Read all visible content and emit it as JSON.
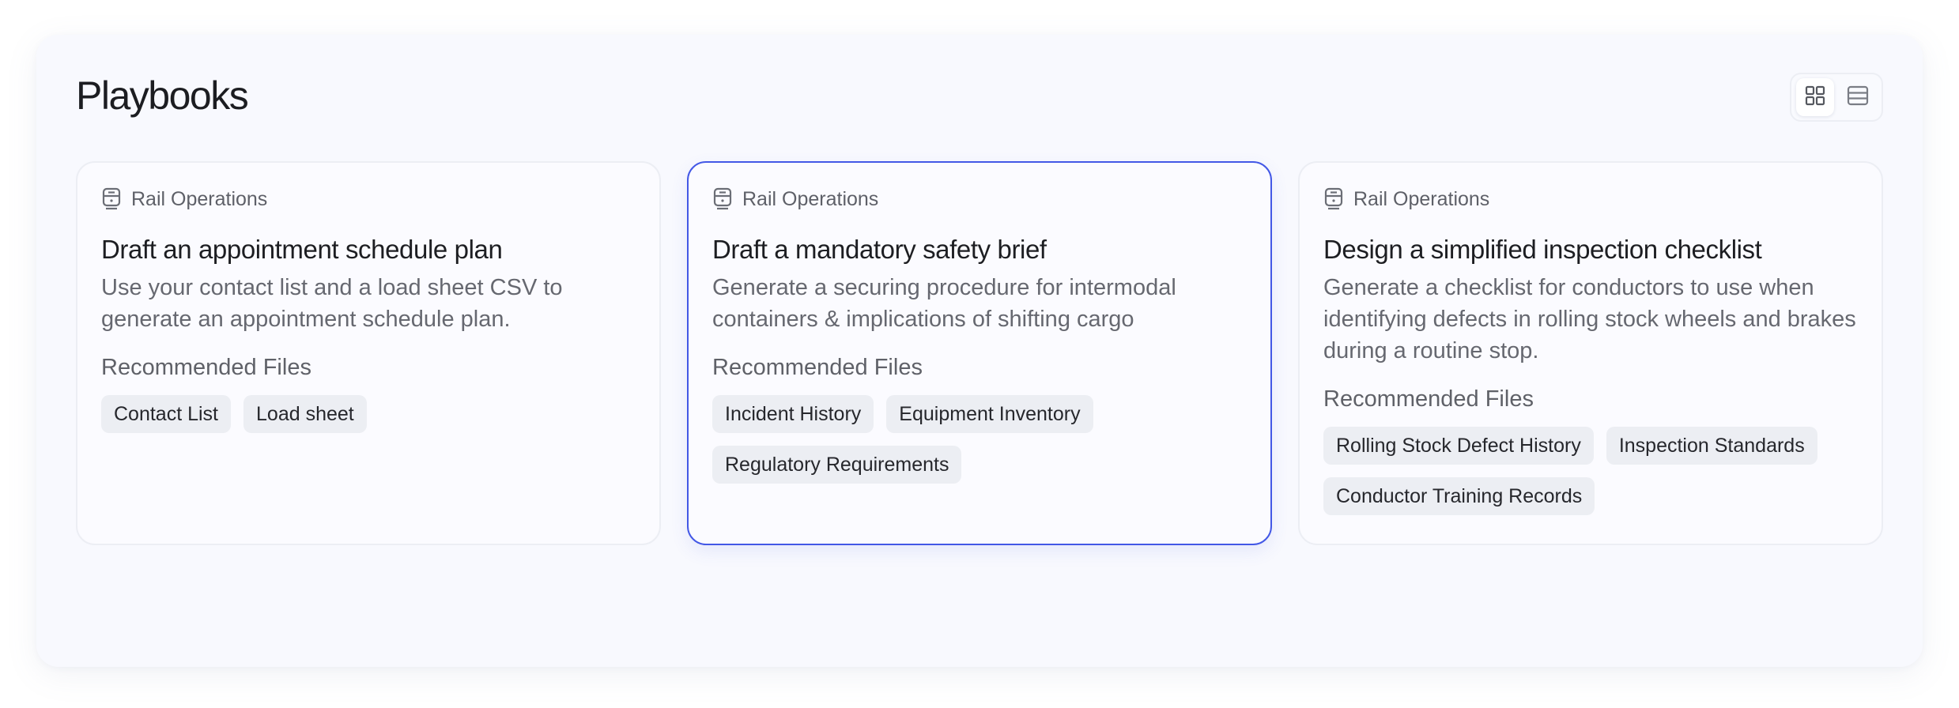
{
  "page": {
    "title": "Playbooks"
  },
  "view_toggle": {
    "options": [
      {
        "icon": "grid-view-icon",
        "active": true
      },
      {
        "icon": "list-view-icon",
        "active": false
      }
    ]
  },
  "cards": [
    {
      "category": "Rail Operations",
      "category_icon": "train-icon",
      "title": "Draft an appointment schedule plan",
      "description_lines": [
        "Use your contact list and a load sheet CSV to",
        "generate an appointment schedule plan."
      ],
      "recommended_label": "Recommended Files",
      "files": [
        "Contact List",
        "Load sheet"
      ],
      "selected": false
    },
    {
      "category": "Rail Operations",
      "category_icon": "train-icon",
      "title": "Draft a mandatory safety brief",
      "description_lines": [
        "Generate a securing procedure for intermodal",
        "containers & implications of shifting cargo"
      ],
      "recommended_label": "Recommended Files",
      "files": [
        "Incident History",
        "Equipment Inventory",
        "Regulatory Requirements"
      ],
      "selected": true
    },
    {
      "category": "Rail Operations",
      "category_icon": "train-icon",
      "title": "Design a simplified inspection checklist",
      "description_lines": [
        "Generate a checklist for conductors to use when",
        "identifying defects in rolling stock wheels and brakes",
        "during a routine stop."
      ],
      "recommended_label": "Recommended Files",
      "files": [
        "Rolling Stock Defect History",
        "Inspection Standards",
        "Conductor Training Records"
      ],
      "selected": false
    }
  ],
  "colors": {
    "accent": "#4358e6",
    "panel": "#f8f9fe",
    "chip": "#eceef3"
  }
}
